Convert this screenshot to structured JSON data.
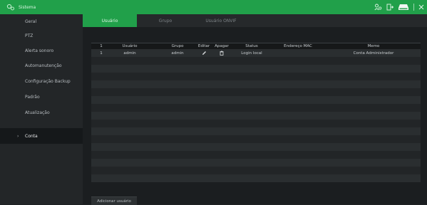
{
  "titlebar": {
    "title": "Sistema"
  },
  "sidebar": {
    "items": [
      {
        "label": "Geral"
      },
      {
        "label": "PTZ"
      },
      {
        "label": "Alerta sonoro"
      },
      {
        "label": "Automanutenção"
      },
      {
        "label": "Configuração Backup"
      },
      {
        "label": "Padrão"
      },
      {
        "label": "Atualização"
      },
      {
        "label": "Conta",
        "active": true
      }
    ],
    "arrow": "›"
  },
  "tabs": [
    {
      "label": "Usuário",
      "active": true
    },
    {
      "label": "Grupo"
    },
    {
      "label": "Usuário ONVIF"
    }
  ],
  "table": {
    "headers": [
      "1",
      "Usuário",
      "Grupo",
      "Editar",
      "Apagar",
      "Status",
      "Endereço MAC",
      "Memo"
    ],
    "rows": [
      {
        "index": "1",
        "user": "admin",
        "group": "admin",
        "status": "Login local",
        "mac": "",
        "memo": "Conta Administrador"
      }
    ]
  },
  "footer": {
    "add_button": "Adicionar usuário"
  },
  "colors": {
    "accent": "#21a04a"
  }
}
